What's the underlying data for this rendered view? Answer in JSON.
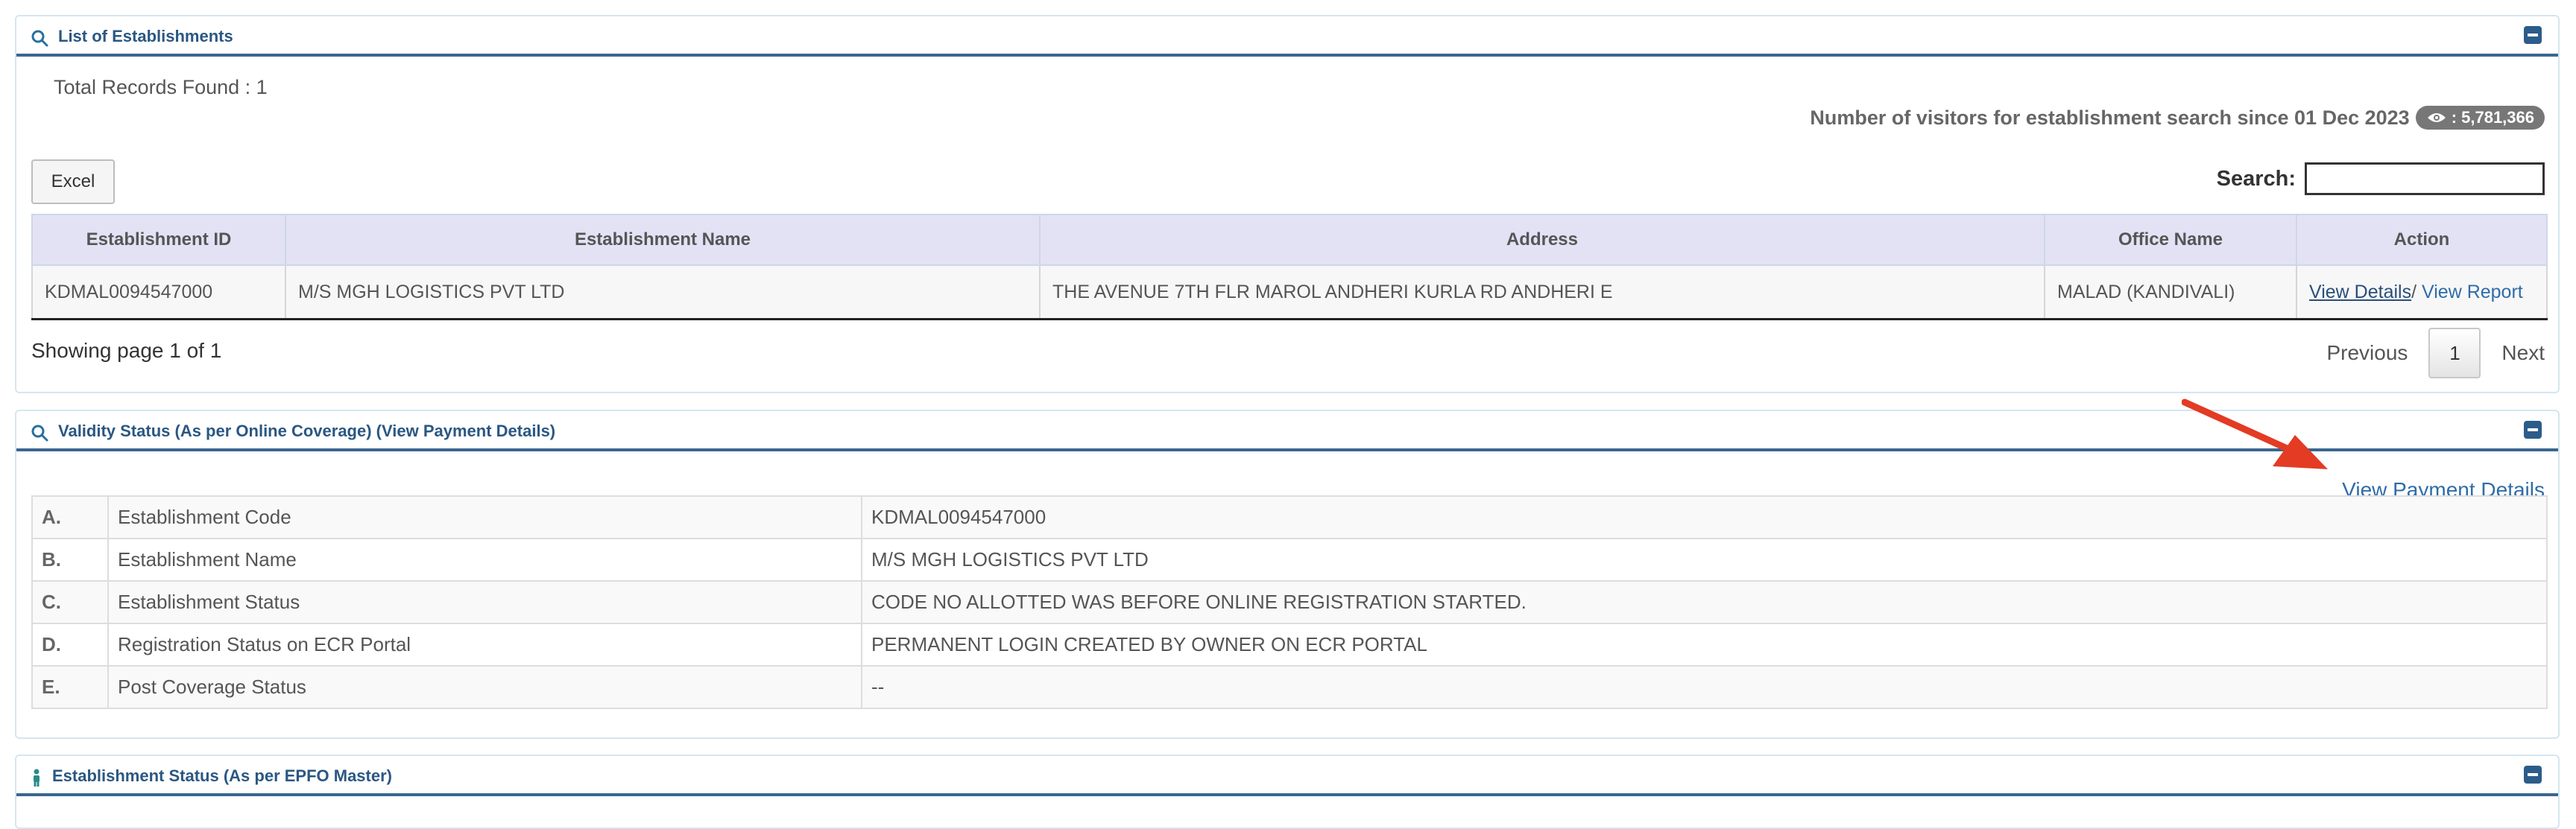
{
  "list_panel": {
    "title": "List of Establishments",
    "total_records": "Total Records Found : 1",
    "visitors_text": "Number of visitors for establishment search since 01 Dec 2023",
    "visitors_count": ": 5,781,366",
    "excel_label": "Excel",
    "search_label": "Search:",
    "search_value": "",
    "columns": [
      "Establishment ID",
      "Establishment Name",
      "Address",
      "Office Name",
      "Action"
    ],
    "rows": [
      {
        "id": "KDMAL0094547000",
        "name": "M/S MGH LOGISTICS PVT LTD",
        "address": "THE AVENUE 7TH FLR MAROL ANDHERI KURLA RD ANDHERI E",
        "office": "MALAD (KANDIVALI)",
        "action_details": "View Details",
        "action_sep": "/",
        "action_report": "View Report"
      }
    ],
    "showing": "Showing page 1 of 1",
    "pager": {
      "previous": "Previous",
      "current": "1",
      "next": "Next"
    }
  },
  "validity_panel": {
    "title": "Validity Status (As per Online Coverage) (View Payment Details)",
    "view_payment_link": "View Payment Details",
    "rows": [
      {
        "letter": "A.",
        "label": "Establishment Code",
        "value": "KDMAL0094547000"
      },
      {
        "letter": "B.",
        "label": "Establishment Name",
        "value": "M/S MGH LOGISTICS PVT LTD"
      },
      {
        "letter": "C.",
        "label": "Establishment Status",
        "value": "CODE NO ALLOTTED WAS BEFORE ONLINE REGISTRATION STARTED."
      },
      {
        "letter": "D.",
        "label": "Registration Status on ECR Portal",
        "value": "PERMANENT LOGIN CREATED BY OWNER ON ECR PORTAL"
      },
      {
        "letter": "E.",
        "label": "Post Coverage Status",
        "value": "--"
      }
    ]
  },
  "epfo_panel": {
    "title": "Establishment Status (As per EPFO Master)"
  },
  "colors": {
    "header_blue": "#2a5782",
    "link_blue": "#2f6ca8",
    "table_header_bg": "#e3e2f5",
    "arrow_red": "#e33b24",
    "badge_gray": "#777777"
  }
}
